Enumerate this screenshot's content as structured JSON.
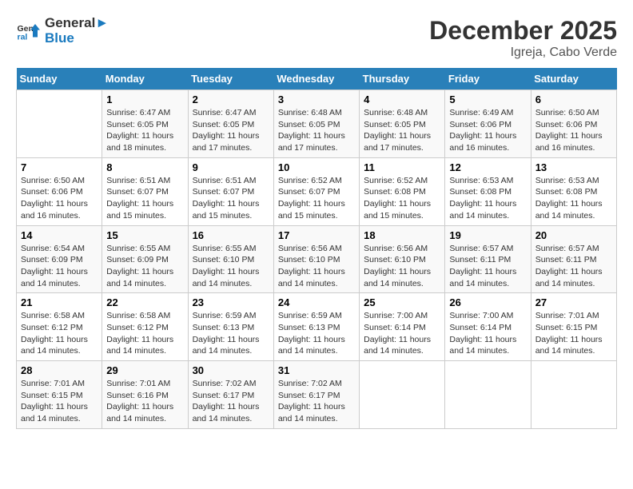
{
  "header": {
    "logo_line1": "General",
    "logo_line2": "Blue",
    "main_title": "December 2025",
    "subtitle": "Igreja, Cabo Verde"
  },
  "days_of_week": [
    "Sunday",
    "Monday",
    "Tuesday",
    "Wednesday",
    "Thursday",
    "Friday",
    "Saturday"
  ],
  "weeks": [
    [
      {
        "day": "",
        "sunrise": "",
        "sunset": "",
        "daylight": ""
      },
      {
        "day": "1",
        "sunrise": "Sunrise: 6:47 AM",
        "sunset": "Sunset: 6:05 PM",
        "daylight": "Daylight: 11 hours and 18 minutes."
      },
      {
        "day": "2",
        "sunrise": "Sunrise: 6:47 AM",
        "sunset": "Sunset: 6:05 PM",
        "daylight": "Daylight: 11 hours and 17 minutes."
      },
      {
        "day": "3",
        "sunrise": "Sunrise: 6:48 AM",
        "sunset": "Sunset: 6:05 PM",
        "daylight": "Daylight: 11 hours and 17 minutes."
      },
      {
        "day": "4",
        "sunrise": "Sunrise: 6:48 AM",
        "sunset": "Sunset: 6:05 PM",
        "daylight": "Daylight: 11 hours and 17 minutes."
      },
      {
        "day": "5",
        "sunrise": "Sunrise: 6:49 AM",
        "sunset": "Sunset: 6:06 PM",
        "daylight": "Daylight: 11 hours and 16 minutes."
      },
      {
        "day": "6",
        "sunrise": "Sunrise: 6:50 AM",
        "sunset": "Sunset: 6:06 PM",
        "daylight": "Daylight: 11 hours and 16 minutes."
      }
    ],
    [
      {
        "day": "7",
        "sunrise": "Sunrise: 6:50 AM",
        "sunset": "Sunset: 6:06 PM",
        "daylight": "Daylight: 11 hours and 16 minutes."
      },
      {
        "day": "8",
        "sunrise": "Sunrise: 6:51 AM",
        "sunset": "Sunset: 6:07 PM",
        "daylight": "Daylight: 11 hours and 15 minutes."
      },
      {
        "day": "9",
        "sunrise": "Sunrise: 6:51 AM",
        "sunset": "Sunset: 6:07 PM",
        "daylight": "Daylight: 11 hours and 15 minutes."
      },
      {
        "day": "10",
        "sunrise": "Sunrise: 6:52 AM",
        "sunset": "Sunset: 6:07 PM",
        "daylight": "Daylight: 11 hours and 15 minutes."
      },
      {
        "day": "11",
        "sunrise": "Sunrise: 6:52 AM",
        "sunset": "Sunset: 6:08 PM",
        "daylight": "Daylight: 11 hours and 15 minutes."
      },
      {
        "day": "12",
        "sunrise": "Sunrise: 6:53 AM",
        "sunset": "Sunset: 6:08 PM",
        "daylight": "Daylight: 11 hours and 14 minutes."
      },
      {
        "day": "13",
        "sunrise": "Sunrise: 6:53 AM",
        "sunset": "Sunset: 6:08 PM",
        "daylight": "Daylight: 11 hours and 14 minutes."
      }
    ],
    [
      {
        "day": "14",
        "sunrise": "Sunrise: 6:54 AM",
        "sunset": "Sunset: 6:09 PM",
        "daylight": "Daylight: 11 hours and 14 minutes."
      },
      {
        "day": "15",
        "sunrise": "Sunrise: 6:55 AM",
        "sunset": "Sunset: 6:09 PM",
        "daylight": "Daylight: 11 hours and 14 minutes."
      },
      {
        "day": "16",
        "sunrise": "Sunrise: 6:55 AM",
        "sunset": "Sunset: 6:10 PM",
        "daylight": "Daylight: 11 hours and 14 minutes."
      },
      {
        "day": "17",
        "sunrise": "Sunrise: 6:56 AM",
        "sunset": "Sunset: 6:10 PM",
        "daylight": "Daylight: 11 hours and 14 minutes."
      },
      {
        "day": "18",
        "sunrise": "Sunrise: 6:56 AM",
        "sunset": "Sunset: 6:10 PM",
        "daylight": "Daylight: 11 hours and 14 minutes."
      },
      {
        "day": "19",
        "sunrise": "Sunrise: 6:57 AM",
        "sunset": "Sunset: 6:11 PM",
        "daylight": "Daylight: 11 hours and 14 minutes."
      },
      {
        "day": "20",
        "sunrise": "Sunrise: 6:57 AM",
        "sunset": "Sunset: 6:11 PM",
        "daylight": "Daylight: 11 hours and 14 minutes."
      }
    ],
    [
      {
        "day": "21",
        "sunrise": "Sunrise: 6:58 AM",
        "sunset": "Sunset: 6:12 PM",
        "daylight": "Daylight: 11 hours and 14 minutes."
      },
      {
        "day": "22",
        "sunrise": "Sunrise: 6:58 AM",
        "sunset": "Sunset: 6:12 PM",
        "daylight": "Daylight: 11 hours and 14 minutes."
      },
      {
        "day": "23",
        "sunrise": "Sunrise: 6:59 AM",
        "sunset": "Sunset: 6:13 PM",
        "daylight": "Daylight: 11 hours and 14 minutes."
      },
      {
        "day": "24",
        "sunrise": "Sunrise: 6:59 AM",
        "sunset": "Sunset: 6:13 PM",
        "daylight": "Daylight: 11 hours and 14 minutes."
      },
      {
        "day": "25",
        "sunrise": "Sunrise: 7:00 AM",
        "sunset": "Sunset: 6:14 PM",
        "daylight": "Daylight: 11 hours and 14 minutes."
      },
      {
        "day": "26",
        "sunrise": "Sunrise: 7:00 AM",
        "sunset": "Sunset: 6:14 PM",
        "daylight": "Daylight: 11 hours and 14 minutes."
      },
      {
        "day": "27",
        "sunrise": "Sunrise: 7:01 AM",
        "sunset": "Sunset: 6:15 PM",
        "daylight": "Daylight: 11 hours and 14 minutes."
      }
    ],
    [
      {
        "day": "28",
        "sunrise": "Sunrise: 7:01 AM",
        "sunset": "Sunset: 6:15 PM",
        "daylight": "Daylight: 11 hours and 14 minutes."
      },
      {
        "day": "29",
        "sunrise": "Sunrise: 7:01 AM",
        "sunset": "Sunset: 6:16 PM",
        "daylight": "Daylight: 11 hours and 14 minutes."
      },
      {
        "day": "30",
        "sunrise": "Sunrise: 7:02 AM",
        "sunset": "Sunset: 6:17 PM",
        "daylight": "Daylight: 11 hours and 14 minutes."
      },
      {
        "day": "31",
        "sunrise": "Sunrise: 7:02 AM",
        "sunset": "Sunset: 6:17 PM",
        "daylight": "Daylight: 11 hours and 14 minutes."
      },
      {
        "day": "",
        "sunrise": "",
        "sunset": "",
        "daylight": ""
      },
      {
        "day": "",
        "sunrise": "",
        "sunset": "",
        "daylight": ""
      },
      {
        "day": "",
        "sunrise": "",
        "sunset": "",
        "daylight": ""
      }
    ]
  ]
}
